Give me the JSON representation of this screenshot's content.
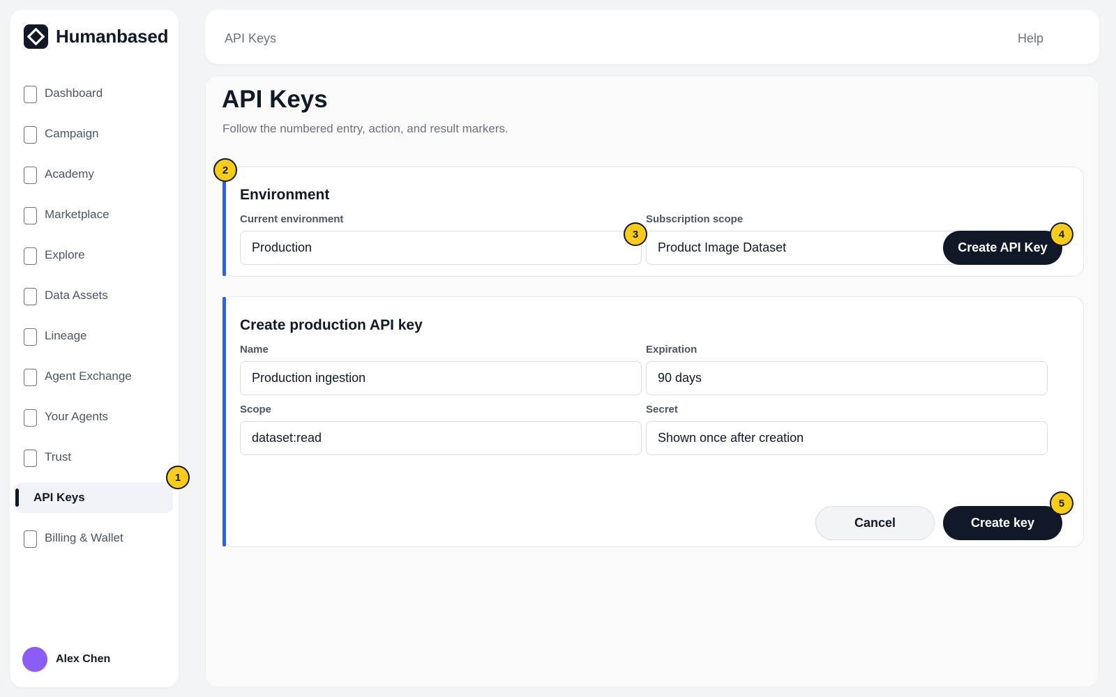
{
  "app": {
    "name": "Humanbased"
  },
  "sidebar": {
    "items": [
      {
        "label": "Dashboard"
      },
      {
        "label": "Campaign"
      },
      {
        "label": "Academy"
      },
      {
        "label": "Marketplace"
      },
      {
        "label": "Explore"
      },
      {
        "label": "Data Assets"
      },
      {
        "label": "Lineage"
      },
      {
        "label": "Agent Exchange"
      },
      {
        "label": "Your Agents"
      },
      {
        "label": "Trust"
      },
      {
        "label": "API Keys",
        "active": true
      },
      {
        "label": "Billing & Wallet"
      }
    ],
    "user": {
      "name": "Alex Chen",
      "avatar_color": "#8b5cf6"
    }
  },
  "topbar": {
    "breadcrumb": "API Keys",
    "help_label": "Help"
  },
  "page": {
    "title": "API Keys",
    "subtitle": "Follow the numbered entry, action, and result markers."
  },
  "environment": {
    "title": "Environment",
    "current_env_label": "Current environment",
    "current_env_value": "Production",
    "subscription_label": "Subscription scope",
    "subscription_value": "Product Image Dataset",
    "create_button": "Create API Key"
  },
  "create_form": {
    "title": "Create production API key",
    "name_label": "Name",
    "name_value": "Production ingestion",
    "expiration_label": "Expiration",
    "expiration_value": "90 days",
    "scope_label": "Scope",
    "scope_value": "dataset:read",
    "secret_label": "Secret",
    "secret_value": "Shown once after creation",
    "cancel_button": "Cancel",
    "submit_button": "Create key"
  },
  "markers": [
    "1",
    "2",
    "3",
    "4",
    "5"
  ],
  "colors": {
    "accent": "#2563eb",
    "marker": "#facc15",
    "dark": "#111827"
  }
}
